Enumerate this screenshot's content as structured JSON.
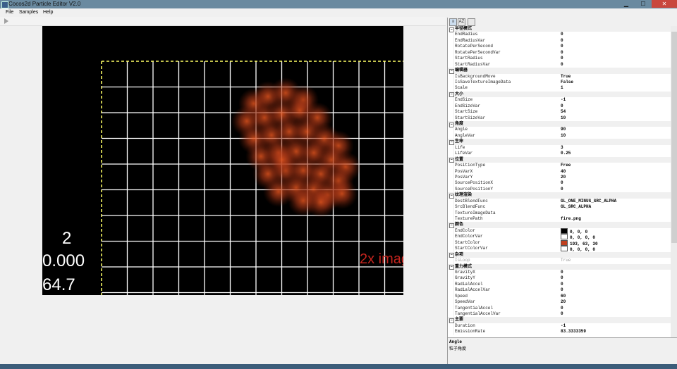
{
  "window": {
    "title": "Cocos2d Particle Editor V2.0"
  },
  "menu": [
    "File",
    "Samples",
    "Help"
  ],
  "stats": {
    "line1": "2",
    "line2": "0.000",
    "line3": "64.7"
  },
  "overlay_text": "2x imag",
  "panel_toolbar": {
    "categorized": "≡",
    "alphabetical": "AZ",
    "pages": ""
  },
  "properties": [
    {
      "category": "半径模式",
      "items": [
        {
          "name": "EndRadius",
          "value": "0"
        },
        {
          "name": "EndRadiusVar",
          "value": "0"
        },
        {
          "name": "RotatePerSecond",
          "value": "0"
        },
        {
          "name": "RotatePerSecondVar",
          "value": "0"
        },
        {
          "name": "StartRadius",
          "value": "0"
        },
        {
          "name": "StartRadiusVar",
          "value": "0"
        }
      ]
    },
    {
      "category": "编辑器",
      "items": [
        {
          "name": "IsBackgroundMove",
          "value": "True"
        },
        {
          "name": "IsSaveTextureImageData",
          "value": "False"
        },
        {
          "name": "Scale",
          "value": "1"
        }
      ]
    },
    {
      "category": "大小",
      "items": [
        {
          "name": "EndSize",
          "value": "-1"
        },
        {
          "name": "EndSizeVar",
          "value": "0"
        },
        {
          "name": "StartSize",
          "value": "54"
        },
        {
          "name": "StartSizeVar",
          "value": "10"
        }
      ]
    },
    {
      "category": "角度",
      "items": [
        {
          "name": "Angle",
          "value": "90"
        },
        {
          "name": "AngleVar",
          "value": "10"
        }
      ]
    },
    {
      "category": "生命",
      "items": [
        {
          "name": "Life",
          "value": "3"
        },
        {
          "name": "LifeVar",
          "value": "0.25"
        }
      ]
    },
    {
      "category": "位置",
      "items": [
        {
          "name": "PositionType",
          "value": "Free"
        },
        {
          "name": "PosVarX",
          "value": "40"
        },
        {
          "name": "PosVarY",
          "value": "20"
        },
        {
          "name": "SourcePositionX",
          "value": "0"
        },
        {
          "name": "SourcePositionY",
          "value": "0"
        }
      ]
    },
    {
      "category": "纹理渲染",
      "items": [
        {
          "name": "DestBlendFunc",
          "value": "GL_ONE_MINUS_SRC_ALPHA"
        },
        {
          "name": "SrcBlendFunc",
          "value": "GL_SRC_ALPHA"
        },
        {
          "name": "TextureImageData",
          "value": ""
        },
        {
          "name": "TexturePath",
          "value": "fire.png"
        }
      ]
    },
    {
      "category": "颜色",
      "items": [
        {
          "name": "EndColor",
          "value": "0, 0, 0",
          "swatch": "#000000"
        },
        {
          "name": "EndColorVar",
          "value": "0, 0, 0, 0",
          "swatch": "#ffffff"
        },
        {
          "name": "StartColor",
          "value": "193, 63, 30",
          "swatch": "#c13f1e"
        },
        {
          "name": "StartColorVar",
          "value": "0, 0, 0, 0",
          "swatch": "#ffffff"
        }
      ]
    },
    {
      "category": "杂项",
      "items": [
        {
          "name": "IsLoop",
          "value": "True",
          "disabled": true
        }
      ]
    },
    {
      "category": "重力模式",
      "items": [
        {
          "name": "GravityX",
          "value": "0"
        },
        {
          "name": "GravityY",
          "value": "0"
        },
        {
          "name": "RadialAccel",
          "value": "0"
        },
        {
          "name": "RadialAccelVar",
          "value": "0"
        },
        {
          "name": "Speed",
          "value": "60"
        },
        {
          "name": "SpeedVar",
          "value": "20"
        },
        {
          "name": "TangentialAccel",
          "value": "0"
        },
        {
          "name": "TangentialAccelVar",
          "value": "0"
        }
      ]
    },
    {
      "category": "主要",
      "items": [
        {
          "name": "Duration",
          "value": "-1"
        },
        {
          "name": "EmissionRate",
          "value": "83.3333359"
        }
      ]
    }
  ],
  "description": {
    "title": "Angle",
    "text": "粒子角度"
  },
  "colors": {
    "particle": "#c13f1e",
    "overlay": "#c4241e",
    "grid": "#ffffff",
    "guide": "#ffff66"
  }
}
